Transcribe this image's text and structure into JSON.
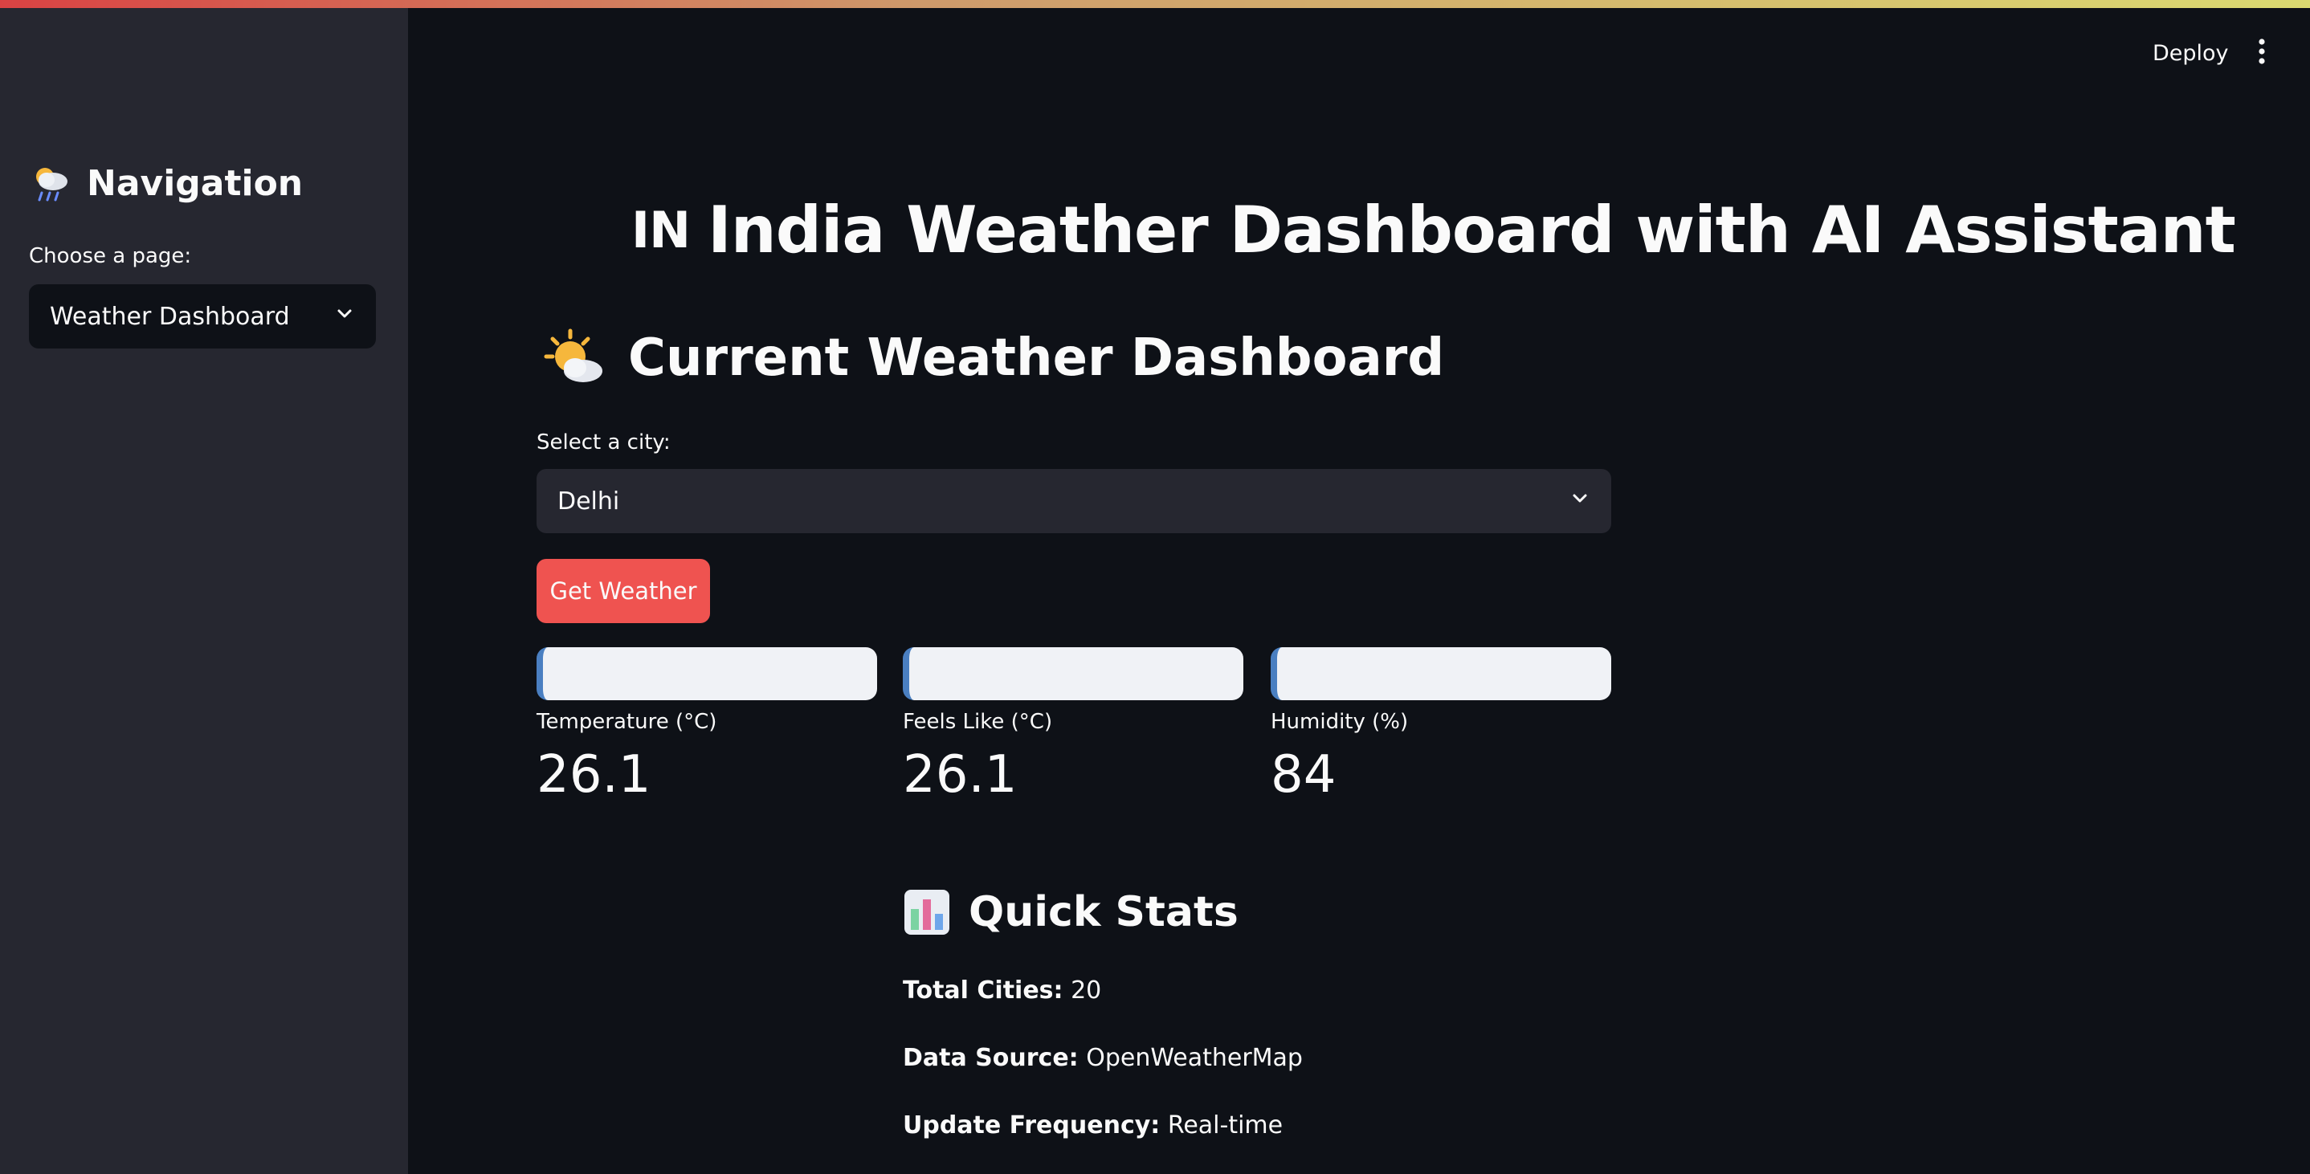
{
  "app": {
    "header": {
      "deploy_label": "Deploy",
      "menu_icon": "kebab-menu-icon"
    },
    "sidebar": {
      "title_icon": "rain-cloud-sun-icon",
      "title": "Navigation",
      "page_select_label": "Choose a page:",
      "page_select_value": "Weather Dashboard"
    },
    "main": {
      "page_title_flag": "IN",
      "page_title": "India Weather Dashboard with AI Assistant",
      "section_icon": "sun-behind-cloud-icon",
      "section_title": "Current Weather Dashboard",
      "city_select_label": "Select a city:",
      "city_select_value": "Delhi",
      "get_weather_button": "Get Weather",
      "metrics": [
        {
          "label": "Temperature (°C)",
          "value": "26.1"
        },
        {
          "label": "Feels Like (°C)",
          "value": "26.1"
        },
        {
          "label": "Humidity (%)",
          "value": "84"
        }
      ],
      "quick_stats": {
        "icon": "bar-chart-icon",
        "title": "Quick Stats",
        "items": [
          {
            "key": "Total Cities:",
            "value": "20"
          },
          {
            "key": "Data Source:",
            "value": "OpenWeatherMap"
          },
          {
            "key": "Update Frequency:",
            "value": "Real-time"
          }
        ]
      }
    },
    "colors": {
      "background": "#0e1117",
      "sidebar": "#262730",
      "primary_button": "#ef5350",
      "metric_bar": "#f0f2f6",
      "metric_bar_accent": "#4a7fc1"
    }
  }
}
